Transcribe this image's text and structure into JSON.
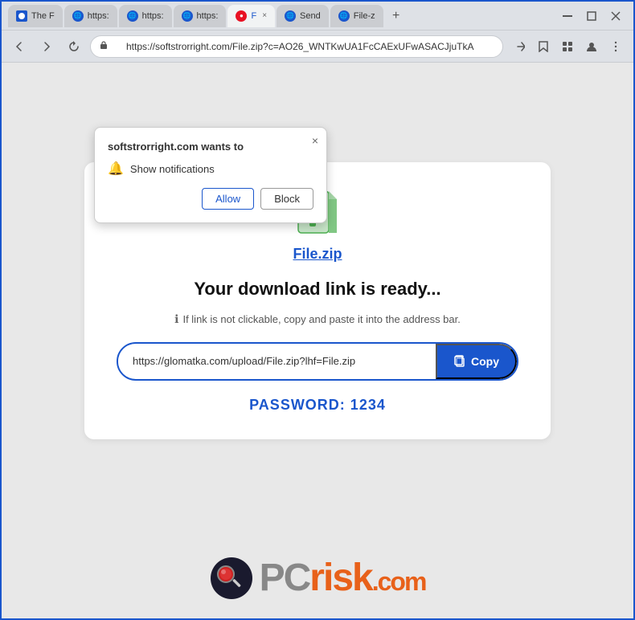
{
  "browser": {
    "tabs": [
      {
        "id": "tab1",
        "label": "The F",
        "favicon_color": "#1a56cc",
        "active": false
      },
      {
        "id": "tab2",
        "label": "https:",
        "favicon_color": "#1a56cc",
        "active": false
      },
      {
        "id": "tab3",
        "label": "https:",
        "favicon_color": "#1a56cc",
        "active": false
      },
      {
        "id": "tab4",
        "label": "https:",
        "favicon_color": "#1a56cc",
        "active": false
      },
      {
        "id": "tab5",
        "label": "F ×",
        "favicon_color": "#e81123",
        "active": true
      },
      {
        "id": "tab6",
        "label": "Send",
        "favicon_color": "#1a56cc",
        "active": false
      },
      {
        "id": "tab7",
        "label": "File-z",
        "favicon_color": "#1a56cc",
        "active": false
      }
    ],
    "address": "https://softstrorright.com/File.zip?c=AO26_WNTKwUA1FcCAExUFwASACJjuTkA",
    "window_controls": {
      "minimize": "—",
      "maximize": "□",
      "close": "✕"
    }
  },
  "notification_popup": {
    "title": "softstrorright.com wants to",
    "item_icon": "🔔",
    "item_text": "Show notifications",
    "allow_label": "Allow",
    "block_label": "Block",
    "close_label": "×"
  },
  "download_card": {
    "file_name": "File.zip",
    "headline": "Your download link is ready...",
    "info_text": "If link is not clickable, copy and paste it into the address bar.",
    "link_url": "https://glomatka.com/upload/File.zip?lhf=File.zip",
    "copy_label": "Copy",
    "password_label": "PASSWORD: 1234"
  },
  "footer": {
    "logo_text_pc": "PC",
    "logo_text_risk": "risk",
    "logo_domain": ".com"
  }
}
